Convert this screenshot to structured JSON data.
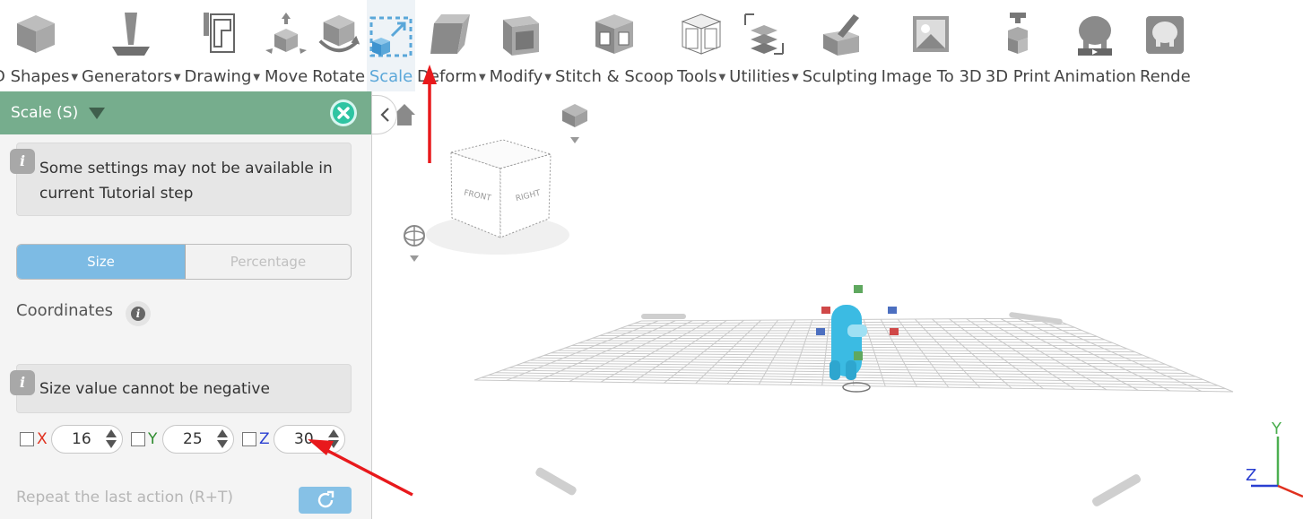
{
  "toolbar": {
    "items": [
      {
        "label": "D Shapes",
        "icon": "cube-icon",
        "caret": true
      },
      {
        "label": "Generators",
        "icon": "generators-icon",
        "caret": true
      },
      {
        "label": "Drawing",
        "icon": "drawing-icon",
        "caret": true
      },
      {
        "label": "Move",
        "icon": "move-icon",
        "caret": false
      },
      {
        "label": "Rotate",
        "icon": "rotate-icon",
        "caret": false
      },
      {
        "label": "Scale",
        "icon": "scale-icon",
        "caret": false,
        "active": true
      },
      {
        "label": "Deform",
        "icon": "deform-icon",
        "caret": true
      },
      {
        "label": "Modify",
        "icon": "modify-icon",
        "caret": true
      },
      {
        "label": "Stitch & Scoop",
        "icon": "stitch-scoop-icon",
        "caret": false
      },
      {
        "label": "Tools",
        "icon": "tools-icon",
        "caret": true
      },
      {
        "label": "Utilities",
        "icon": "utilities-icon",
        "caret": true
      },
      {
        "label": "Sculpting",
        "icon": "sculpting-icon",
        "caret": false
      },
      {
        "label": "Image To 3D",
        "icon": "image-to-3d-icon",
        "caret": false
      },
      {
        "label": "3D Print",
        "icon": "3d-print-icon",
        "caret": false
      },
      {
        "label": "Animation",
        "icon": "animation-icon",
        "caret": false
      },
      {
        "label": "Rende",
        "icon": "render-icon",
        "caret": false
      }
    ]
  },
  "panel": {
    "title": "Scale (S)",
    "info_tutorial": "Some settings may not be available in current Tutorial step",
    "mode_size": "Size",
    "mode_percentage": "Percentage",
    "coordinates_label": "Coordinates",
    "info_negative": "Size value cannot be negative",
    "axes": [
      {
        "letter": "X",
        "value": "16",
        "color": "#e0301e"
      },
      {
        "letter": "Y",
        "value": "25",
        "color": "#2e8b2e"
      },
      {
        "letter": "Z",
        "value": "30",
        "color": "#2a3fd1"
      }
    ],
    "repeat_label": "Repeat the last action (R+T)"
  },
  "viewport": {
    "cube_front": "FRONT",
    "cube_right": "RIGHT",
    "axis_y": "Y",
    "axis_z": "Z",
    "colors": {
      "grid": "#c9c9c9",
      "object": "#3bbbe3",
      "annotation": "#e8191c"
    }
  }
}
